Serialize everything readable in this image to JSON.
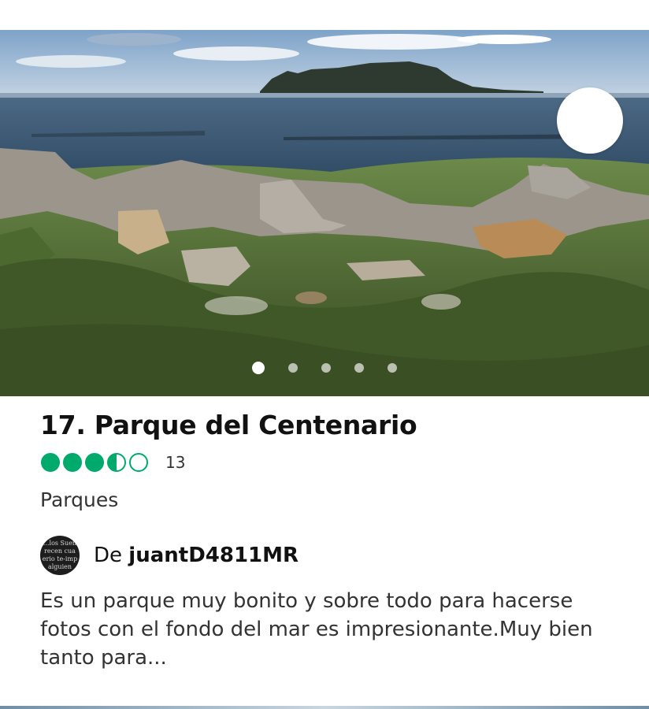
{
  "card": {
    "photo": {
      "alt": "",
      "icon_favorite": "heart-icon",
      "carousel_count": 5,
      "carousel_active": 1
    },
    "title": "17. Parque del Centenario",
    "rating": {
      "value": 3.5,
      "max": 5,
      "count": "13",
      "color": "#00aa6c"
    },
    "category": "Parques",
    "review": {
      "author_prefix": "De",
      "author_name": "juantD4811MR",
      "avatar_text": [
        "...los Sueñ",
        "recen cua",
        "erio te-imp",
        "alguien"
      ],
      "text": "Es un parque muy bonito y sobre todo para hacerse fotos con el fondo del mar es impresionante.Muy bien tanto para..."
    }
  }
}
